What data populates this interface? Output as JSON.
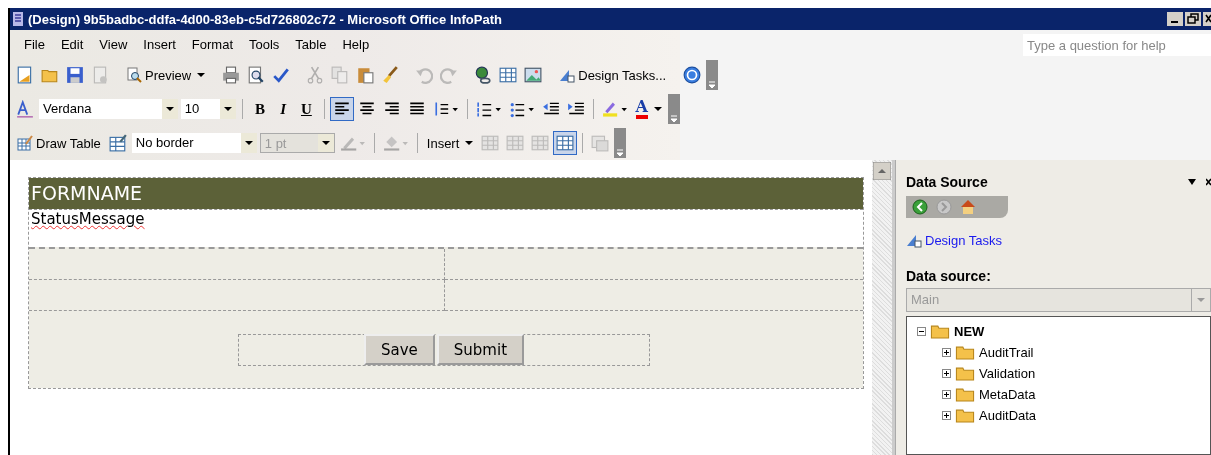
{
  "window": {
    "title": "(Design) 9b5badbc-ddfa-4d00-83eb-c5d726802c72 - Microsoft Office InfoPath"
  },
  "menu": [
    "File",
    "Edit",
    "View",
    "Insert",
    "Format",
    "Tools",
    "Table",
    "Help"
  ],
  "help_box": {
    "placeholder": "Type a question for help"
  },
  "standard_toolbar": {
    "preview": "Preview",
    "design_tasks": "Design Tasks..."
  },
  "format_toolbar": {
    "font": "Verdana",
    "size": "10",
    "styles": [
      "B",
      "I",
      "U"
    ],
    "alignment": [
      {
        "selected": true
      },
      {
        "selected": false
      },
      {
        "selected": false
      },
      {
        "selected": false
      }
    ],
    "font_color_label": "A"
  },
  "table_toolbar": {
    "draw_table": "Draw Table",
    "border": "No border",
    "weight": {
      "value": "1 pt",
      "disabled": true
    },
    "insert": "Insert",
    "table_grid_selected": true
  },
  "form": {
    "header": "FORMNAME",
    "status": "StatusMessage",
    "buttons": [
      "Save",
      "Submit"
    ]
  },
  "task_pane": {
    "title": "Data Source",
    "nav": [
      {
        "disabled": false
      },
      {
        "disabled": true
      },
      {
        "disabled": false
      }
    ],
    "link": "Design Tasks",
    "source_label": "Data source:",
    "source": {
      "value": "Main",
      "disabled": true
    },
    "tree": [
      {
        "label": "NEW",
        "expanded": true,
        "children": [
          {
            "label": "AuditTrail",
            "expanded": false
          },
          {
            "label": "Validation",
            "expanded": false
          },
          {
            "label": "MetaData",
            "expanded": false
          },
          {
            "label": "AuditData",
            "expanded": false
          }
        ]
      }
    ]
  }
}
